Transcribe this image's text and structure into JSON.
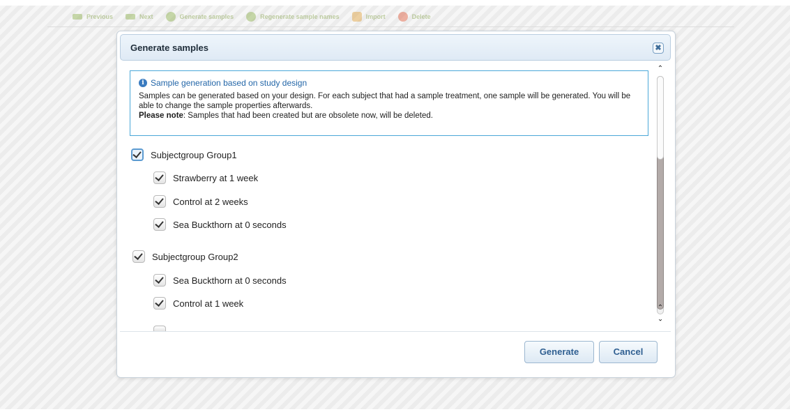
{
  "toolbar": {
    "previous": "Previous",
    "next": "Next",
    "generate": "Generate samples",
    "regenerate": "Regenerate sample names",
    "import": "Import",
    "delete": "Delete"
  },
  "dialog": {
    "title": "Generate samples",
    "close_symbol": "✖",
    "info": {
      "heading": "Sample generation based on study design",
      "text": "Samples can be generated based on your design. For each subject that had a sample treatment, one sample will be generated. You will be able to change the sample properties afterwards.",
      "note_label": "Please note",
      "note_text": ": Samples that had been created but are obsolete now, will be deleted."
    },
    "groups": [
      {
        "label": "Subjectgroup Group1",
        "checked": true,
        "items": [
          {
            "label": "Strawberry at 1 week",
            "checked": true
          },
          {
            "label": "Control at 2 weeks",
            "checked": true
          },
          {
            "label": "Sea Buckthorn at 0 seconds",
            "checked": true
          }
        ]
      },
      {
        "label": "Subjectgroup Group2",
        "checked": true,
        "items": [
          {
            "label": "Sea Buckthorn at 0 seconds",
            "checked": true
          },
          {
            "label": "Control at 1 week",
            "checked": true
          }
        ]
      }
    ],
    "buttons": {
      "generate": "Generate",
      "cancel": "Cancel"
    }
  },
  "colors": {
    "accent": "#2f5f91",
    "info_border": "#4aa7d8",
    "info_heading": "#2366a8"
  }
}
